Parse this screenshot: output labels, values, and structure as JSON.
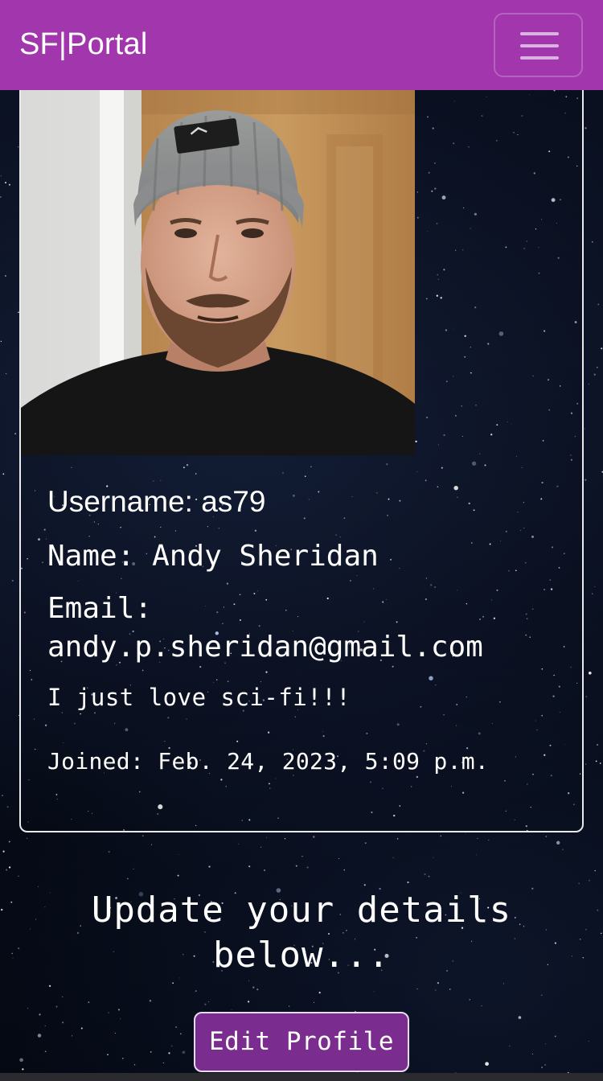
{
  "navbar": {
    "brand": "SF|Portal",
    "toggler_icon": "hamburger-menu-icon",
    "color": "#a236ad"
  },
  "profile": {
    "username_label": "Username:",
    "username": "as79",
    "name_label": "Name:",
    "name": "Andy Sheridan",
    "email_label": "Email:",
    "email": "andy.p.sheridan@gmail.com",
    "bio": "I just love sci-fi!!!",
    "joined_label": "Joined:",
    "joined": "Feb. 24, 2023, 5:09 p.m."
  },
  "update": {
    "heading": "Update your details below...",
    "edit_button": "Edit Profile",
    "button_color": "#7a2c8f"
  }
}
